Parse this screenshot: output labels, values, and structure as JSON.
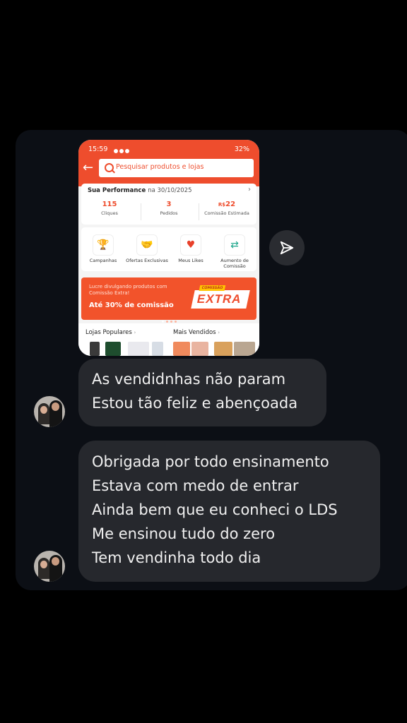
{
  "thread": {
    "shared_screenshot": {
      "status_bar": {
        "time": "15:59",
        "battery": "32%"
      },
      "search": {
        "placeholder": "Pesquisar produtos e lojas"
      },
      "performance": {
        "title": "Sua Performance",
        "date_text": "na 30/10/2025",
        "metrics": [
          {
            "value": "115",
            "label": "Cliques"
          },
          {
            "value": "3",
            "label": "Pedidos"
          },
          {
            "currency": "R$",
            "value": "22",
            "label": "Comissão Estimada"
          }
        ]
      },
      "categories": [
        {
          "label": "Campanhas",
          "icon": "trophy-icon"
        },
        {
          "label": "Ofertas Exclusivas",
          "icon": "handshake-icon"
        },
        {
          "label": "Meus Likes",
          "icon": "heart-icon"
        },
        {
          "label": "Aumento de Comissão",
          "icon": "money-exchange-icon"
        }
      ],
      "banner": {
        "line1": "Lucre divulgando produtos com Comissão Extra!",
        "line2": "Até 30% de comissão",
        "badge_top": "COMISSÃO",
        "badge": "EXTRA"
      },
      "sections": {
        "left": "Lojas Populares",
        "right": "Mais Vendidos",
        "arrow": "›"
      }
    },
    "messages": [
      {
        "lines": [
          "As vendidnhas não param",
          "Estou tão feliz e abençoada"
        ]
      },
      {
        "lines": [
          "Obrigada por todo ensinamento",
          "Estava com medo de entrar",
          "Ainda bem que eu conheci o LDS",
          "Me ensinou tudo do zero",
          "Tem vendinha todo dia"
        ]
      }
    ],
    "colors": {
      "brand": "#ee4d2d",
      "bubble": "#26282d",
      "panel": "#0c0f15"
    }
  }
}
